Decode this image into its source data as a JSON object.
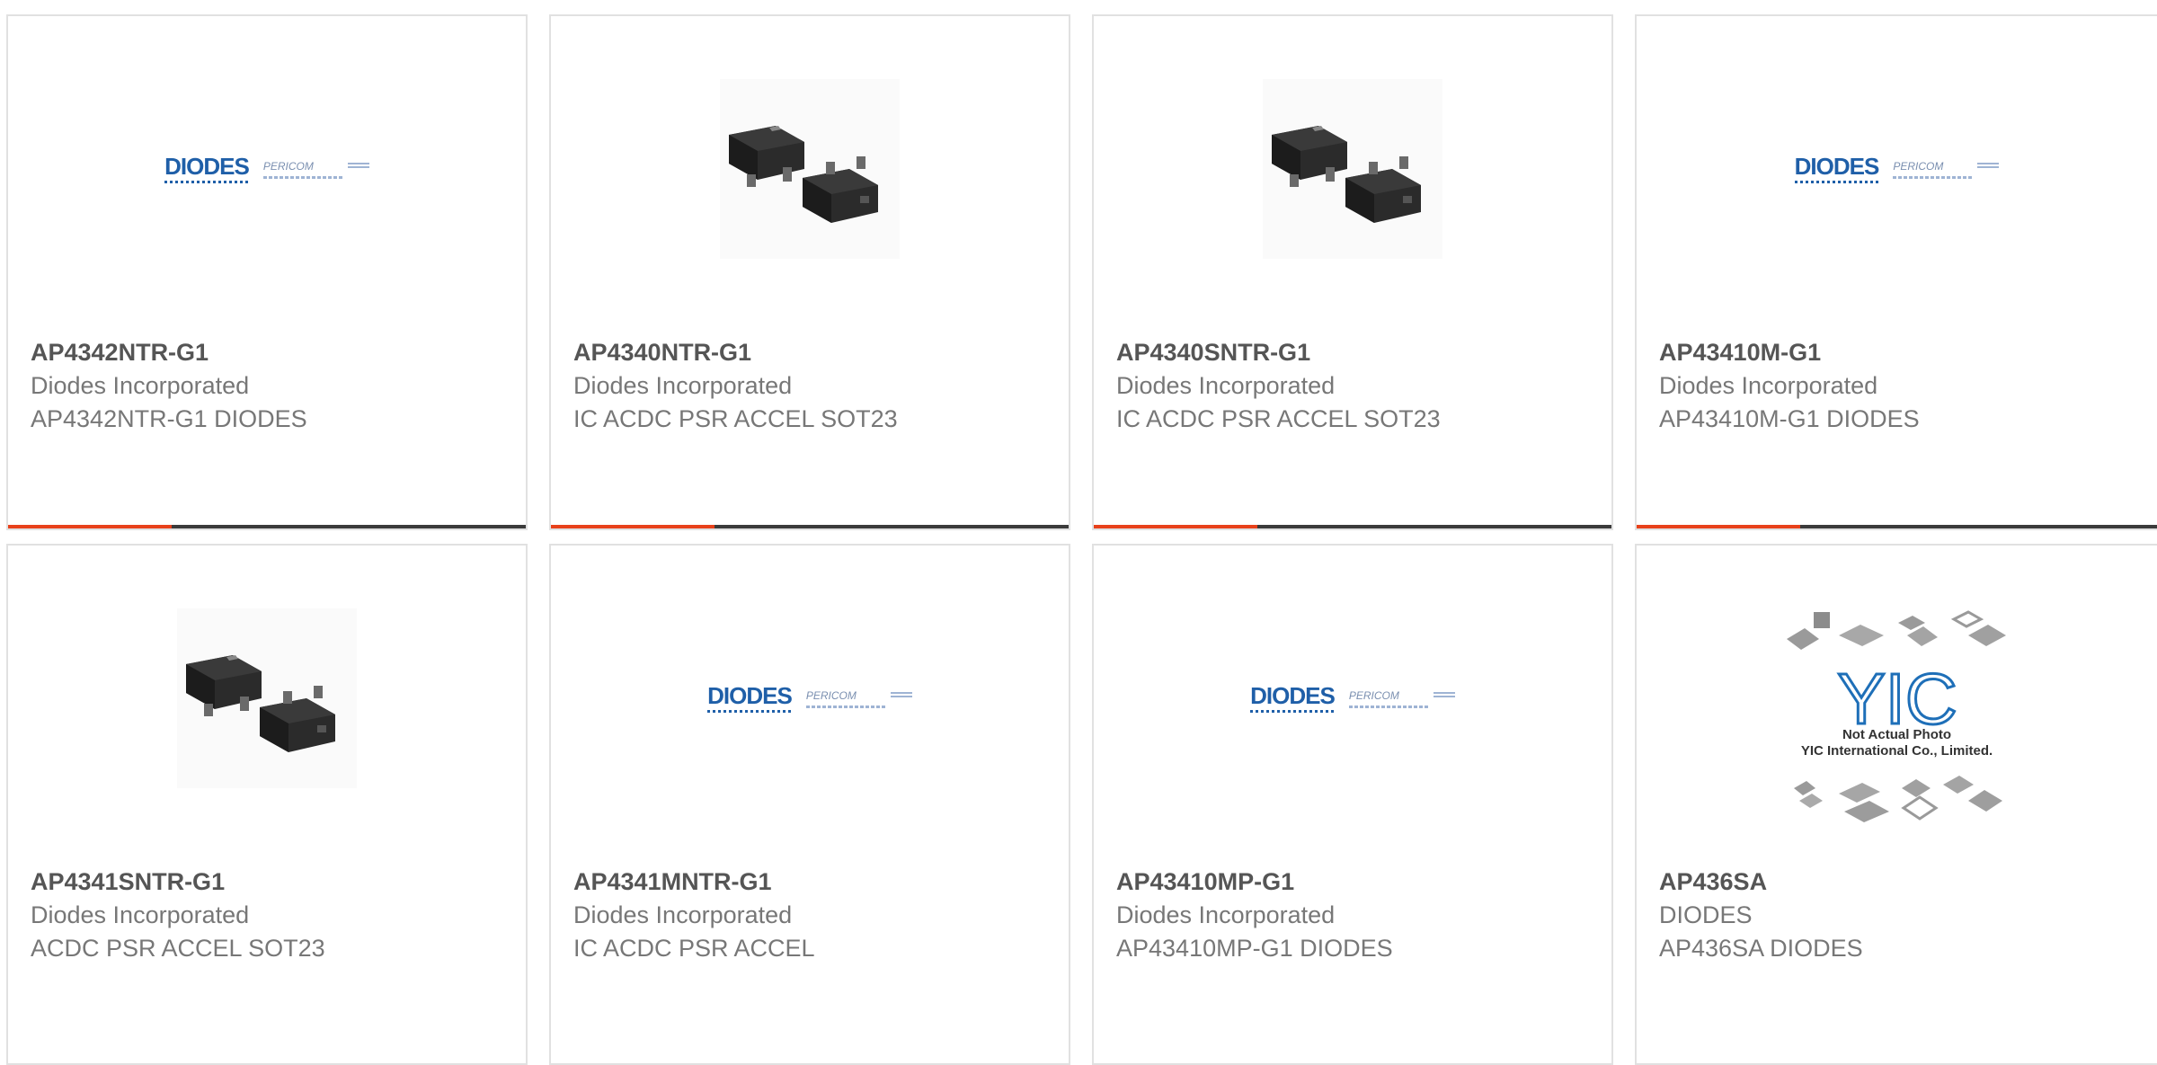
{
  "products": [
    {
      "part_number": "AP4342NTR-G1",
      "manufacturer": "Diodes Incorporated",
      "description": "AP4342NTR-G1 DIODES",
      "image": "diodes-logo"
    },
    {
      "part_number": "AP4340NTR-G1",
      "manufacturer": "Diodes Incorporated",
      "description": "IC ACDC PSR ACCEL SOT23",
      "image": "sot23-package"
    },
    {
      "part_number": "AP4340SNTR-G1",
      "manufacturer": "Diodes Incorporated",
      "description": "IC ACDC PSR ACCEL SOT23",
      "image": "sot23-package"
    },
    {
      "part_number": "AP43410M-G1",
      "manufacturer": "Diodes Incorporated",
      "description": "AP43410M-G1 DIODES",
      "image": "diodes-logo"
    },
    {
      "part_number": "AP4341SNTR-G1",
      "manufacturer": "Diodes Incorporated",
      "description": "ACDC PSR ACCEL SOT23",
      "image": "sot23-package"
    },
    {
      "part_number": "AP4341MNTR-G1",
      "manufacturer": "Diodes Incorporated",
      "description": "IC ACDC PSR ACCEL",
      "image": "diodes-logo"
    },
    {
      "part_number": "AP43410MP-G1",
      "manufacturer": "Diodes Incorporated",
      "description": "AP43410MP-G1 DIODES",
      "image": "diodes-logo"
    },
    {
      "part_number": "AP436SA",
      "manufacturer": "DIODES",
      "description": "AP436SA DIODES",
      "image": "yic-not-actual-photo"
    }
  ],
  "logos": {
    "diodes_word": "DIODES",
    "pericom_word": "PERICOM"
  },
  "yic": {
    "mark": "YIC",
    "caption_line1": "Not Actual Photo",
    "caption_line2": "YIC International Co., Limited."
  },
  "colors": {
    "accent": "#e8411b",
    "bar": "#3b3b3b",
    "card_border": "#e1e1e1",
    "part_text": "#555555",
    "meta_text": "#777777"
  }
}
